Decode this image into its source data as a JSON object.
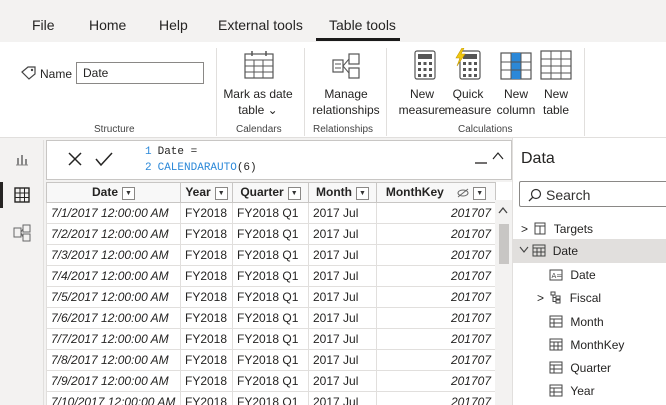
{
  "menubar": {
    "items": [
      "File",
      "Home",
      "Help",
      "External tools",
      "Table tools"
    ],
    "active": "Table tools"
  },
  "ribbon": {
    "name_label": "Name",
    "name_value": "Date",
    "buttons": {
      "mark_date_table": [
        "Mark as date",
        "table ⌄"
      ],
      "manage_rel": [
        "Manage",
        "relationships"
      ],
      "new_measure": [
        "New",
        "measure"
      ],
      "quick_measure": [
        "Quick",
        "measure"
      ],
      "new_column": [
        "New",
        "column"
      ],
      "new_table": [
        "New",
        "table"
      ]
    },
    "groups": {
      "structure": "Structure",
      "calendars": "Calendars",
      "relationships": "Relationships",
      "calculations": "Calculations"
    }
  },
  "formula": {
    "line1_no": "1",
    "line1": "Date =",
    "line2_no": "2",
    "line2_fn": "CALENDARAUTO",
    "line2_args": "(6)"
  },
  "table": {
    "headers": [
      "Date",
      "Year",
      "Quarter",
      "Month",
      "MonthKey"
    ],
    "rows": [
      [
        "7/1/2017 12:00:00 AM",
        "FY2018",
        "FY2018 Q1",
        "2017 Jul",
        "201707"
      ],
      [
        "7/2/2017 12:00:00 AM",
        "FY2018",
        "FY2018 Q1",
        "2017 Jul",
        "201707"
      ],
      [
        "7/3/2017 12:00:00 AM",
        "FY2018",
        "FY2018 Q1",
        "2017 Jul",
        "201707"
      ],
      [
        "7/4/2017 12:00:00 AM",
        "FY2018",
        "FY2018 Q1",
        "2017 Jul",
        "201707"
      ],
      [
        "7/5/2017 12:00:00 AM",
        "FY2018",
        "FY2018 Q1",
        "2017 Jul",
        "201707"
      ],
      [
        "7/6/2017 12:00:00 AM",
        "FY2018",
        "FY2018 Q1",
        "2017 Jul",
        "201707"
      ],
      [
        "7/7/2017 12:00:00 AM",
        "FY2018",
        "FY2018 Q1",
        "2017 Jul",
        "201707"
      ],
      [
        "7/8/2017 12:00:00 AM",
        "FY2018",
        "FY2018 Q1",
        "2017 Jul",
        "201707"
      ],
      [
        "7/9/2017 12:00:00 AM",
        "FY2018",
        "FY2018 Q1",
        "2017 Jul",
        "201707"
      ],
      [
        "7/10/2017 12:00:00 AM",
        "FY2018",
        "FY2018 Q1",
        "2017 Jul",
        "201707"
      ]
    ]
  },
  "data_pane": {
    "title": "Data",
    "search_placeholder": "Search",
    "items": {
      "targets": "Targets",
      "date": "Date",
      "date_col": "Date",
      "fiscal": "Fiscal",
      "month": "Month",
      "monthkey": "MonthKey",
      "quarter": "Quarter",
      "year": "Year"
    }
  },
  "colors": {
    "accent": "#2b88d8",
    "quick_measure_yellow": "#f2c811"
  }
}
